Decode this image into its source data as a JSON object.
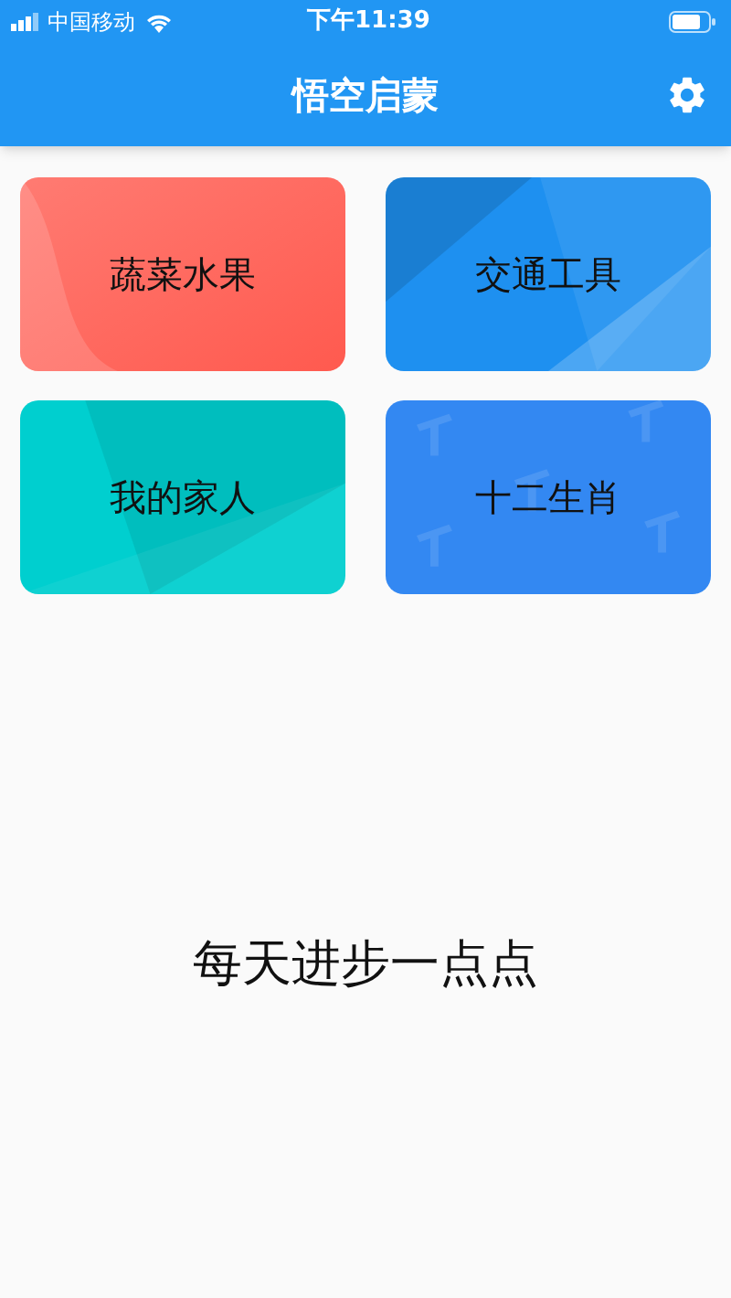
{
  "status_bar": {
    "carrier": "中国移动",
    "time": "下午11:39"
  },
  "app_bar": {
    "title": "悟空启蒙"
  },
  "categories": [
    {
      "label": "蔬菜水果",
      "color": "#ff5a4f"
    },
    {
      "label": "交通工具",
      "color": "#1e90f0"
    },
    {
      "label": "我的家人",
      "color": "#00cfcf"
    },
    {
      "label": "十二生肖",
      "color": "#3388f2"
    }
  ],
  "motto": "每天进步一点点"
}
